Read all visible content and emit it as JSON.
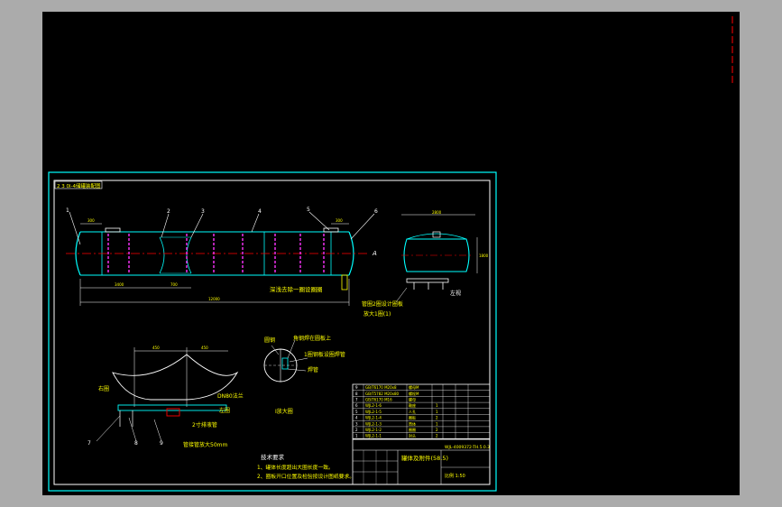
{
  "colors": {
    "background": "#ababab",
    "canvas": "#000000",
    "frame": "#ffffff",
    "border": "#00ffff",
    "geometry": "#00ffff",
    "centerline": "#ff0000",
    "dimension": "#ffffff",
    "leader": "#ffffff",
    "welds": "#ff33ff",
    "annotation": "#ffff00",
    "text": "#ffffff"
  },
  "drawing": {
    "title_tag": "2 3 0l-4储罐装配图",
    "part_numbers": {
      "p1": "1",
      "p2": "2",
      "p3": "3",
      "p4": "4",
      "p5": "5",
      "p6": "6",
      "p7": "7",
      "p8": "8",
      "p9": "9"
    },
    "dims": {
      "d_left": "300",
      "d_right": "300",
      "d_span1": "3400",
      "d_span2": "700",
      "d_total": "12000",
      "d_side_w": "2800",
      "d_side_h": "1800",
      "d_det_a": "450",
      "d_det_b": "450"
    },
    "notes": {
      "side_label": "A",
      "hatch_note": "深浅去除一圈设圈圈",
      "gasket_note": "管圈2圈设计圈板",
      "gasket_note2": "放大1圈(1)",
      "left_label": "左圈",
      "left_view": "左视",
      "detail_left": "右圈",
      "detail_right_top": "DN80法兰",
      "detail_right_mid": "左圈",
      "detail_bottom_a": "2寸排液管",
      "detail_bottom_b": "管接管放大50mm",
      "circle_a": "圆钢",
      "circle_b": "角钢焊在圆板上",
      "circle_c": "1圈钢板设圈焊管",
      "circle_d": "焊管",
      "enlarge_label": "I放大圈",
      "tech_title": "技术要求",
      "tech_1": "1、罐体长度超出大圈长度一致。",
      "tech_2": "2、圈板开口位置及检验按设计图纸要求。"
    },
    "title_block": {
      "rows": [
        [
          "9",
          "GB/T6170 M20x8",
          "螺母M",
          ""
        ],
        [
          "8",
          "GB/T5782 M20x80",
          "螺栓M",
          ""
        ],
        [
          "7",
          "GB/T6170 M16",
          "螺母",
          ""
        ],
        [
          "6",
          "WJL2-1-6",
          "鞍座",
          "1"
        ],
        [
          "5",
          "WJL2-1-5",
          "人孔",
          "1"
        ],
        [
          "4",
          "WJL2-1-4",
          "圈板",
          "2"
        ],
        [
          "3",
          "WJL2-1-3",
          "筒体",
          "1"
        ],
        [
          "2",
          "WJL2-1-2",
          "圈圈",
          "2"
        ],
        [
          "1",
          "WJL2-1-1",
          "封头",
          "2"
        ]
      ],
      "drawing_no": "WJL-4009372-TH.5.0.3",
      "title": "罐体及附件(58.5)",
      "scale_row": "比例 1:50"
    }
  }
}
